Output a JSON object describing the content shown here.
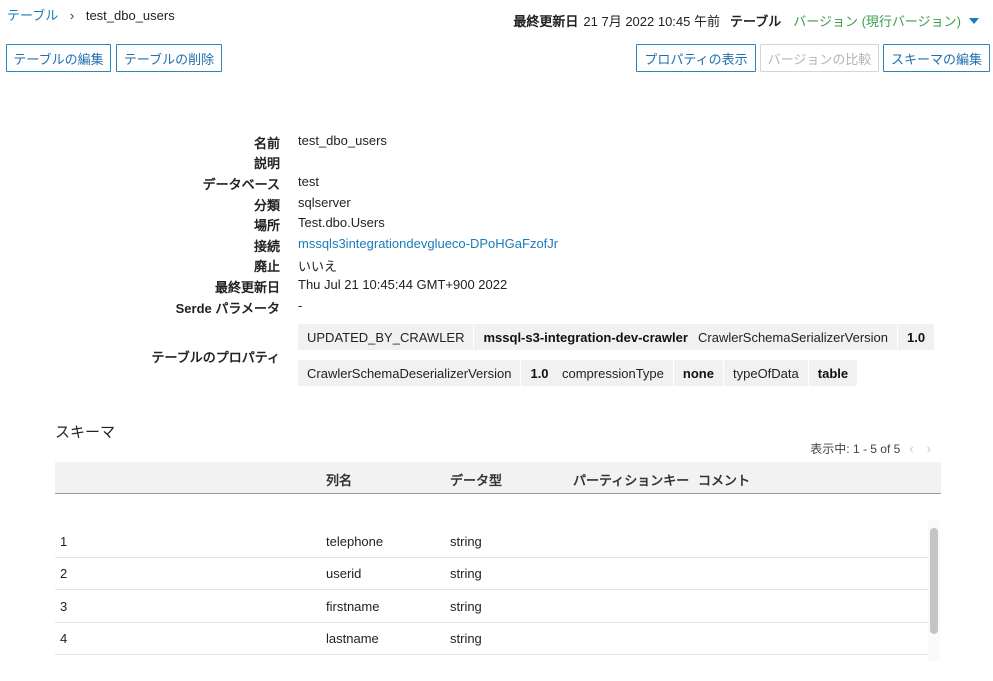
{
  "breadcrumb": {
    "parent": "テーブル",
    "separator": "›",
    "current": "test_dbo_users"
  },
  "header": {
    "last_updated_label": "最終更新日",
    "last_updated_value": "21 7月 2022 10:45 午前",
    "table_label": "テーブル",
    "version_label": "バージョン (現行バージョン)"
  },
  "toolbar": {
    "edit_table": "テーブルの編集",
    "delete_table": "テーブルの削除",
    "view_properties": "プロパティの表示",
    "compare_versions": "バージョンの比較",
    "edit_schema": "スキーマの編集"
  },
  "details": {
    "name_label": "名前",
    "name_value": "test_dbo_users",
    "description_label": "説明",
    "description_value": "",
    "database_label": "データベース",
    "database_value": "test",
    "classification_label": "分類",
    "classification_value": "sqlserver",
    "location_label": "場所",
    "location_value": "Test.dbo.Users",
    "connection_label": "接続",
    "connection_value": "mssqls3integrationdevglueco-DPoHGaFzofJr",
    "deprecated_label": "廃止",
    "deprecated_value": "いいえ",
    "last_updated_label": "最終更新日",
    "last_updated_value": "Thu Jul 21 10:45:44 GMT+900 2022",
    "serde_label": "Serde パラメータ",
    "serde_value": "-",
    "properties_label": "テーブルのプロパティ"
  },
  "properties": [
    {
      "key": "UPDATED_BY_CRAWLER",
      "value": "mssql-s3-integration-dev-crawler"
    },
    {
      "key": "CrawlerSchemaSerializerVersion",
      "value": "1.0"
    },
    {
      "key": "CrawlerSchemaDeserializerVersion",
      "value": "1.0"
    },
    {
      "key": "compressionType",
      "value": "none"
    },
    {
      "key": "typeOfData",
      "value": "table"
    }
  ],
  "schema": {
    "title": "スキーマ",
    "pagination": "表示中: 1 - 5 of 5",
    "columns": {
      "name": "列名",
      "type": "データ型",
      "partition_key": "パーティションキー",
      "comment": "コメント"
    },
    "rows": [
      {
        "index": "1",
        "name": "telephone",
        "type": "string"
      },
      {
        "index": "2",
        "name": "userid",
        "type": "string"
      },
      {
        "index": "3",
        "name": "firstname",
        "type": "string"
      },
      {
        "index": "4",
        "name": "lastname",
        "type": "string"
      }
    ]
  },
  "colors": {
    "link": "#1a7bb9",
    "version_green": "#3a9d4a",
    "button_border": "#2b85c0"
  },
  "icons": {
    "breadcrumb_separator": "chevron-right-icon",
    "version_dropdown": "caret-down-icon",
    "page_prev": "chevron-left-icon",
    "page_next": "chevron-right-icon"
  }
}
